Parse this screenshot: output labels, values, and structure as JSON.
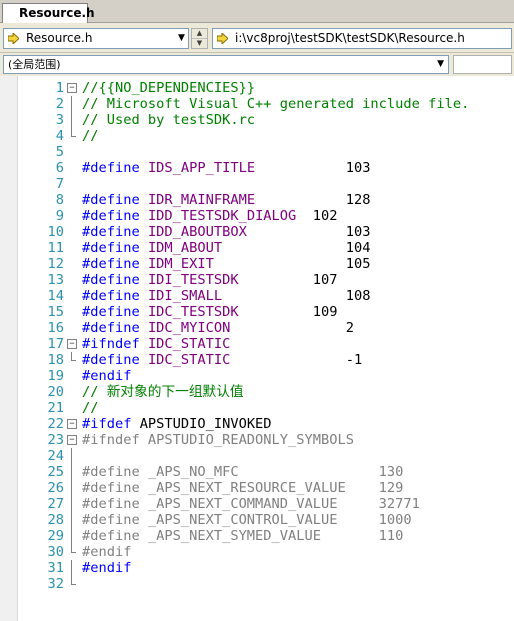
{
  "tab": {
    "title": "Resource.h"
  },
  "nav": {
    "left_combo": "Resource.h",
    "right_combo": "i:\\vc8proj\\testSDK\\testSDK\\Resource.h"
  },
  "scope": {
    "label": "(全局范围)"
  },
  "colors": {
    "keyword": "#0000ff",
    "macro": "#800080",
    "comment": "#008000",
    "inactive": "#808080",
    "line_number": "#2b91af"
  },
  "code_lines": [
    {
      "n": "1",
      "fold": "box",
      "segments": [
        {
          "c": "cm",
          "t": "//{{NO_DEPENDENCIES}}"
        }
      ]
    },
    {
      "n": "2",
      "fold": "line",
      "segments": [
        {
          "c": "cm",
          "t": "// Microsoft Visual C++ generated include file."
        }
      ]
    },
    {
      "n": "3",
      "fold": "line",
      "segments": [
        {
          "c": "cm",
          "t": "// Used by testSDK.rc"
        }
      ]
    },
    {
      "n": "4",
      "fold": "end",
      "segments": [
        {
          "c": "cm",
          "t": "//"
        }
      ]
    },
    {
      "n": "5",
      "fold": "",
      "segments": []
    },
    {
      "n": "6",
      "fold": "",
      "segments": [
        {
          "c": "kw",
          "t": "#define "
        },
        {
          "c": "mac",
          "t": "IDS_APP_TITLE"
        },
        {
          "c": "pl",
          "t": "           103"
        }
      ]
    },
    {
      "n": "7",
      "fold": "",
      "segments": []
    },
    {
      "n": "8",
      "fold": "",
      "segments": [
        {
          "c": "kw",
          "t": "#define "
        },
        {
          "c": "mac",
          "t": "IDR_MAINFRAME"
        },
        {
          "c": "pl",
          "t": "           128"
        }
      ]
    },
    {
      "n": "9",
      "fold": "",
      "segments": [
        {
          "c": "kw",
          "t": "#define "
        },
        {
          "c": "mac",
          "t": "IDD_TESTSDK_DIALOG"
        },
        {
          "c": "pl",
          "t": "  102"
        }
      ]
    },
    {
      "n": "10",
      "fold": "",
      "segments": [
        {
          "c": "kw",
          "t": "#define "
        },
        {
          "c": "mac",
          "t": "IDD_ABOUTBOX"
        },
        {
          "c": "pl",
          "t": "            103"
        }
      ]
    },
    {
      "n": "11",
      "fold": "",
      "segments": [
        {
          "c": "kw",
          "t": "#define "
        },
        {
          "c": "mac",
          "t": "IDM_ABOUT"
        },
        {
          "c": "pl",
          "t": "               104"
        }
      ]
    },
    {
      "n": "12",
      "fold": "",
      "segments": [
        {
          "c": "kw",
          "t": "#define "
        },
        {
          "c": "mac",
          "t": "IDM_EXIT"
        },
        {
          "c": "pl",
          "t": "                105"
        }
      ]
    },
    {
      "n": "13",
      "fold": "",
      "segments": [
        {
          "c": "kw",
          "t": "#define "
        },
        {
          "c": "mac",
          "t": "IDI_TESTSDK"
        },
        {
          "c": "pl",
          "t": "         107"
        }
      ]
    },
    {
      "n": "14",
      "fold": "",
      "segments": [
        {
          "c": "kw",
          "t": "#define "
        },
        {
          "c": "mac",
          "t": "IDI_SMALL"
        },
        {
          "c": "pl",
          "t": "               108"
        }
      ]
    },
    {
      "n": "15",
      "fold": "",
      "segments": [
        {
          "c": "kw",
          "t": "#define "
        },
        {
          "c": "mac",
          "t": "IDC_TESTSDK"
        },
        {
          "c": "pl",
          "t": "         109"
        }
      ]
    },
    {
      "n": "16",
      "fold": "",
      "segments": [
        {
          "c": "kw",
          "t": "#define "
        },
        {
          "c": "mac",
          "t": "IDC_MYICON"
        },
        {
          "c": "pl",
          "t": "              2"
        }
      ]
    },
    {
      "n": "17",
      "fold": "box",
      "segments": [
        {
          "c": "kw",
          "t": "#ifndef "
        },
        {
          "c": "mac",
          "t": "IDC_STATIC"
        }
      ]
    },
    {
      "n": "18",
      "fold": "end",
      "segments": [
        {
          "c": "kw",
          "t": "#define "
        },
        {
          "c": "mac",
          "t": "IDC_STATIC"
        },
        {
          "c": "pl",
          "t": "              -1"
        }
      ]
    },
    {
      "n": "19",
      "fold": "",
      "segments": [
        {
          "c": "kw",
          "t": "#endif"
        }
      ]
    },
    {
      "n": "20",
      "fold": "",
      "segments": [
        {
          "c": "cm",
          "t": "// 新对象的下一组默认值"
        }
      ]
    },
    {
      "n": "21",
      "fold": "",
      "segments": [
        {
          "c": "cm",
          "t": "//"
        }
      ]
    },
    {
      "n": "22",
      "fold": "box",
      "segments": [
        {
          "c": "kw",
          "t": "#ifdef "
        },
        {
          "c": "pl",
          "t": "APSTUDIO_INVOKED"
        }
      ]
    },
    {
      "n": "23",
      "fold": "box",
      "segments": [
        {
          "c": "gr",
          "t": "#ifndef APSTUDIO_READONLY_SYMBOLS"
        }
      ]
    },
    {
      "n": "24",
      "fold": "line",
      "segments": []
    },
    {
      "n": "25",
      "fold": "line",
      "segments": [
        {
          "c": "gr",
          "t": "#define _APS_NO_MFC                 130"
        }
      ]
    },
    {
      "n": "26",
      "fold": "line",
      "segments": [
        {
          "c": "gr",
          "t": "#define _APS_NEXT_RESOURCE_VALUE    129"
        }
      ]
    },
    {
      "n": "27",
      "fold": "line",
      "segments": [
        {
          "c": "gr",
          "t": "#define _APS_NEXT_COMMAND_VALUE     32771"
        }
      ]
    },
    {
      "n": "28",
      "fold": "line",
      "segments": [
        {
          "c": "gr",
          "t": "#define _APS_NEXT_CONTROL_VALUE     1000"
        }
      ]
    },
    {
      "n": "29",
      "fold": "line",
      "segments": [
        {
          "c": "gr",
          "t": "#define _APS_NEXT_SYMED_VALUE       110"
        }
      ]
    },
    {
      "n": "30",
      "fold": "end",
      "segments": [
        {
          "c": "gr",
          "t": "#endif"
        }
      ]
    },
    {
      "n": "31",
      "fold": "line",
      "segments": [
        {
          "c": "kw",
          "t": "#endif"
        }
      ]
    },
    {
      "n": "32",
      "fold": "end",
      "segments": []
    }
  ]
}
